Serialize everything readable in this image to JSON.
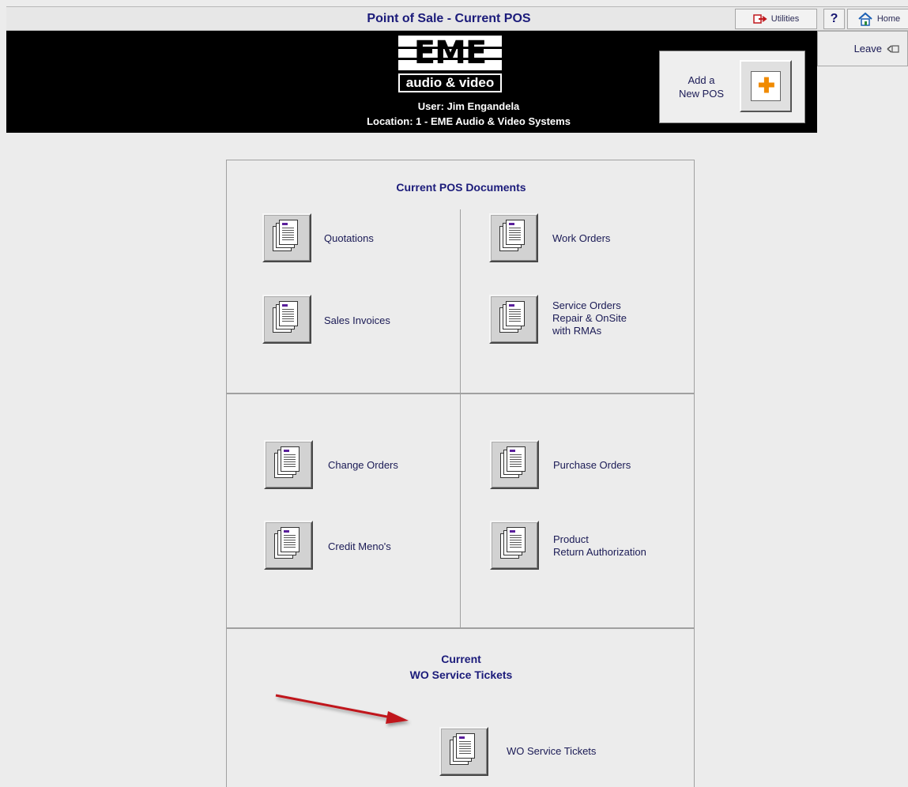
{
  "title": "Point of Sale -  Current POS",
  "toolbar": {
    "utilities": "Utilities",
    "help": "?",
    "home": "Home",
    "leave": "Leave"
  },
  "logo": {
    "top": "EME",
    "bottom": "audio & video"
  },
  "user_line": "User: Jim Engandela",
  "location_line": "Location: 1 - EME Audio & Video Systems",
  "add_pos": {
    "line1": "Add a",
    "line2": "New POS"
  },
  "panel1": {
    "title": "Current POS Documents",
    "items": [
      {
        "lines": [
          "Quotations"
        ]
      },
      {
        "lines": [
          "Work Orders"
        ]
      },
      {
        "lines": [
          "Sales Invoices"
        ]
      },
      {
        "lines": [
          "Service Orders",
          "Repair & OnSite",
          "with RMAs"
        ]
      }
    ]
  },
  "panel2": {
    "items": [
      {
        "lines": [
          "Change Orders"
        ]
      },
      {
        "lines": [
          "Purchase Orders"
        ]
      },
      {
        "lines": [
          "Credit Meno's"
        ]
      },
      {
        "lines": [
          "Product",
          "Return Authorization"
        ]
      }
    ]
  },
  "panel3": {
    "title_line1": "Current",
    "title_line2": "WO Service Tickets",
    "item": "WO Service Tickets"
  },
  "colors": {
    "header_black": "#000000",
    "title_text": "#1b1b7a",
    "arrow_red": "#c0171c",
    "panel_bg": "#ececec"
  }
}
